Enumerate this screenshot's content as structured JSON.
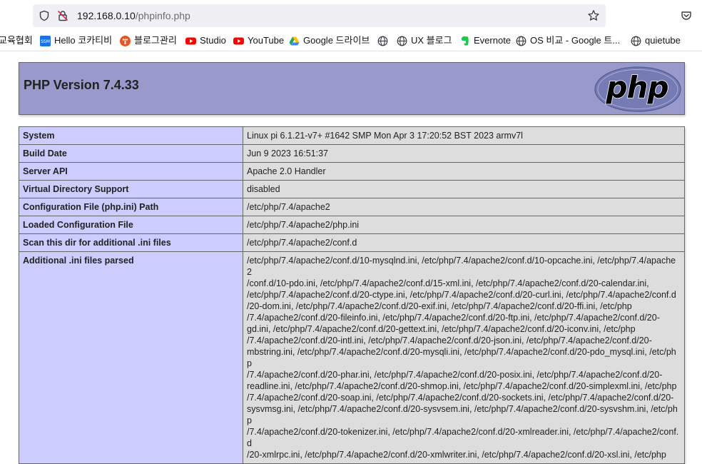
{
  "browser": {
    "url_host": "192.168.0.10",
    "url_path": "/phpinfo.php"
  },
  "bookmarks": [
    {
      "label": "교육협회",
      "icon": "none"
    },
    {
      "label": "Hello 코카티비",
      "icon": "ssm-icon"
    },
    {
      "label": "블로그관리",
      "icon": "tistory-icon"
    },
    {
      "label": "Studio",
      "icon": "youtube-icon"
    },
    {
      "label": "YouTube",
      "icon": "youtube-icon"
    },
    {
      "label": "Google 드라이브",
      "icon": "google-drive-icon"
    },
    {
      "label": "",
      "icon": "globe-icon"
    },
    {
      "label": "UX 블로그",
      "icon": "globe-icon"
    },
    {
      "label": "Evernote",
      "icon": "evernote-icon"
    },
    {
      "label": "OS 비교 - Google 트...",
      "icon": "globe-icon"
    },
    {
      "label": "quietube",
      "icon": "globe-icon"
    }
  ],
  "page": {
    "title": "PHP Version 7.4.33",
    "logo_text": "php"
  },
  "info_table": [
    {
      "key": "System",
      "value": "Linux pi 6.1.21-v7+ #1642 SMP Mon Apr 3 17:20:52 BST 2023 armv7l"
    },
    {
      "key": "Build Date",
      "value": "Jun 9 2023 16:51:37"
    },
    {
      "key": "Server API",
      "value": "Apache 2.0 Handler"
    },
    {
      "key": "Virtual Directory Support",
      "value": "disabled"
    },
    {
      "key": "Configuration File (php.ini) Path",
      "value": "/etc/php/7.4/apache2"
    },
    {
      "key": "Loaded Configuration File",
      "value": "/etc/php/7.4/apache2/php.ini"
    },
    {
      "key": "Scan this dir for additional .ini files",
      "value": "/etc/php/7.4/apache2/conf.d"
    },
    {
      "key": "Additional .ini files parsed",
      "value_lines": [
        "/etc/php/7.4/apache2/conf.d/10-mysqlnd.ini, /etc/php/7.4/apache2/conf.d/10-opcache.ini, /etc/php/7.4/apache2",
        "/conf.d/10-pdo.ini, /etc/php/7.4/apache2/conf.d/15-xml.ini, /etc/php/7.4/apache2/conf.d/20-calendar.ini,",
        "/etc/php/7.4/apache2/conf.d/20-ctype.ini, /etc/php/7.4/apache2/conf.d/20-curl.ini, /etc/php/7.4/apache2/conf.d",
        "/20-dom.ini, /etc/php/7.4/apache2/conf.d/20-exif.ini, /etc/php/7.4/apache2/conf.d/20-ffi.ini, /etc/php",
        "/7.4/apache2/conf.d/20-fileinfo.ini, /etc/php/7.4/apache2/conf.d/20-ftp.ini, /etc/php/7.4/apache2/conf.d/20-",
        "gd.ini, /etc/php/7.4/apache2/conf.d/20-gettext.ini, /etc/php/7.4/apache2/conf.d/20-iconv.ini, /etc/php",
        "/7.4/apache2/conf.d/20-intl.ini, /etc/php/7.4/apache2/conf.d/20-json.ini, /etc/php/7.4/apache2/conf.d/20-",
        "mbstring.ini, /etc/php/7.4/apache2/conf.d/20-mysqli.ini, /etc/php/7.4/apache2/conf.d/20-pdo_mysql.ini, /etc/php",
        "/7.4/apache2/conf.d/20-phar.ini, /etc/php/7.4/apache2/conf.d/20-posix.ini, /etc/php/7.4/apache2/conf.d/20-",
        "readline.ini, /etc/php/7.4/apache2/conf.d/20-shmop.ini, /etc/php/7.4/apache2/conf.d/20-simplexml.ini, /etc/php",
        "/7.4/apache2/conf.d/20-soap.ini, /etc/php/7.4/apache2/conf.d/20-sockets.ini, /etc/php/7.4/apache2/conf.d/20-",
        "sysvmsg.ini, /etc/php/7.4/apache2/conf.d/20-sysvsem.ini, /etc/php/7.4/apache2/conf.d/20-sysvshm.ini, /etc/php",
        "/7.4/apache2/conf.d/20-tokenizer.ini, /etc/php/7.4/apache2/conf.d/20-xmlreader.ini, /etc/php/7.4/apache2/conf.d",
        "/20-xmlrpc.ini, /etc/php/7.4/apache2/conf.d/20-xmlwriter.ini, /etc/php/7.4/apache2/conf.d/20-xsl.ini, /etc/php"
      ]
    }
  ],
  "colors": {
    "header_bg": "#9999cc",
    "key_bg": "#ccccff",
    "value_bg": "#dddddd",
    "border": "#666666"
  }
}
